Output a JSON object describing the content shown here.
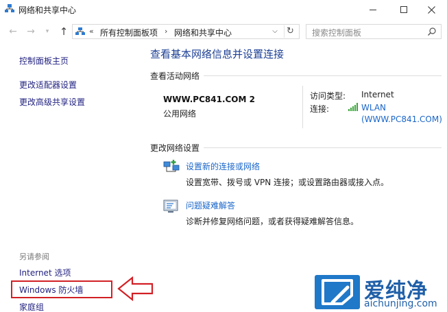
{
  "window": {
    "title": "网络和共享中心",
    "minimize_icon": "minimize-icon",
    "maximize_icon": "maximize-icon",
    "close_icon": "close-icon"
  },
  "navigation": {
    "back_icon": "back-arrow-icon",
    "forward_icon": "forward-arrow-icon",
    "recent_icon": "chevron-down-icon",
    "up_icon": "up-arrow-icon",
    "address": {
      "prefix": "«",
      "crumbs": [
        "所有控制面板项",
        "网络和共享中心"
      ],
      "separator": "›"
    },
    "search_placeholder": "搜索控制面板"
  },
  "sidebar": {
    "home_link": "控制面板主页",
    "links": [
      "更改适配器设置",
      "更改高级共享设置"
    ],
    "see_also_heading": "另请参阅",
    "see_also_links": [
      "Internet 选项",
      "Windows 防火墙",
      "家庭组"
    ],
    "highlight_color": "#d21f24"
  },
  "main": {
    "title": "查看基本网络信息并设置连接",
    "active_networks_heading": "查看活动网络",
    "network": {
      "name": "WWW.PC841.COM  2",
      "category": "公用网络",
      "access_type_label": "访问类型:",
      "access_type_value": "Internet",
      "connections_label": "连接:",
      "connection_line1": "WLAN",
      "connection_line2": "(WWW.PC841.COM)"
    },
    "change_settings_heading": "更改网络设置",
    "tasks": [
      {
        "link": "设置新的连接或网络",
        "description": "设置宽带、拨号或 VPN 连接；或设置路由器或接入点。",
        "icon": "new-connection-icon"
      },
      {
        "link": "问题疑难解答",
        "description": "诊断并修复网络问题，或者获得疑难解答信息。",
        "icon": "troubleshoot-icon"
      }
    ]
  },
  "watermark": {
    "name": "爱纯净",
    "url": "aichunjing.com",
    "color": "#1f78c8"
  }
}
